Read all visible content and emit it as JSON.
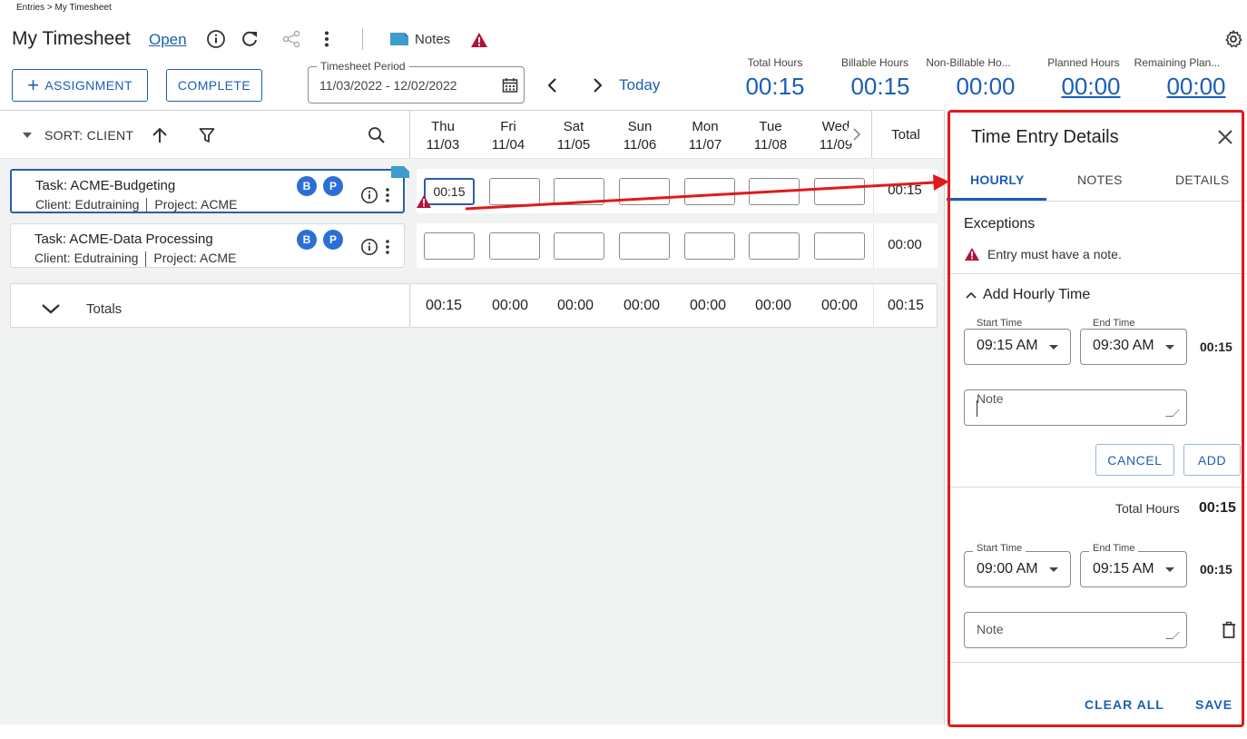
{
  "breadcrumb": "Entries > My Timesheet",
  "header": {
    "title": "My Timesheet",
    "status_link": "Open",
    "notes_label": "Notes"
  },
  "toolbar": {
    "assignment_label": "ASSIGNMENT",
    "complete_label": "COMPLETE",
    "period_label": "Timesheet Period",
    "period_value": "11/03/2022 - 12/02/2022",
    "today_label": "Today"
  },
  "summary": [
    {
      "label": "Total Hours",
      "value": "00:15"
    },
    {
      "label": "Billable Hours",
      "value": "00:15"
    },
    {
      "label": "Non-Billable Ho...",
      "value": "00:00"
    },
    {
      "label": "Planned Hours",
      "value": "00:00"
    },
    {
      "label": "Remaining Plan...",
      "value": "00:00"
    }
  ],
  "grid": {
    "sort_label": "SORT: CLIENT",
    "days": [
      {
        "day": "Thu",
        "date": "11/03"
      },
      {
        "day": "Fri",
        "date": "11/04"
      },
      {
        "day": "Sat",
        "date": "11/05"
      },
      {
        "day": "Sun",
        "date": "11/06"
      },
      {
        "day": "Mon",
        "date": "11/07"
      },
      {
        "day": "Tue",
        "date": "11/08"
      },
      {
        "day": "Wed",
        "date": "11/09"
      }
    ],
    "total_label": "Total",
    "rows": [
      {
        "task": "Task: ACME-Budgeting",
        "client": "Client: Edutraining",
        "project": "Project: ACME",
        "badges": [
          "B",
          "P"
        ],
        "cells": [
          "00:15",
          "",
          "",
          "",
          "",
          "",
          ""
        ],
        "total": "00:15"
      },
      {
        "task": "Task: ACME-Data Processing",
        "client": "Client: Edutraining",
        "project": "Project: ACME",
        "badges": [
          "B",
          "P"
        ],
        "cells": [
          "",
          "",
          "",
          "",
          "",
          "",
          ""
        ],
        "total": "00:00"
      }
    ],
    "totals_label": "Totals",
    "totals": [
      "00:15",
      "00:00",
      "00:00",
      "00:00",
      "00:00",
      "00:00",
      "00:00"
    ],
    "totals_sum": "00:15"
  },
  "panel": {
    "title": "Time Entry Details",
    "tabs": [
      "HOURLY",
      "NOTES",
      "DETAILS"
    ],
    "exceptions_title": "Exceptions",
    "exception_message": "Entry must have a note.",
    "add_hourly_title": "Add Hourly Time",
    "new_entry": {
      "start_label": "Start Time",
      "start_value": "09:15 AM",
      "end_label": "End Time",
      "end_value": "09:30 AM",
      "duration": "00:15",
      "note_placeholder": "Note"
    },
    "cancel_label": "CANCEL",
    "add_label": "ADD",
    "total_hours_label": "Total Hours",
    "total_hours_value": "00:15",
    "existing_entry": {
      "start_label": "Start Time",
      "start_value": "09:00 AM",
      "end_label": "End Time",
      "end_value": "09:15 AM",
      "duration": "00:15",
      "note_placeholder": "Note"
    },
    "clear_all_label": "CLEAR ALL",
    "save_label": "SAVE"
  },
  "colors": {
    "accent": "#1a5fb4",
    "warning": "#b0123a",
    "highlight_frame": "#e01a1a",
    "badge": "#2b6fd6",
    "note_tag": "#3d9ccc"
  }
}
